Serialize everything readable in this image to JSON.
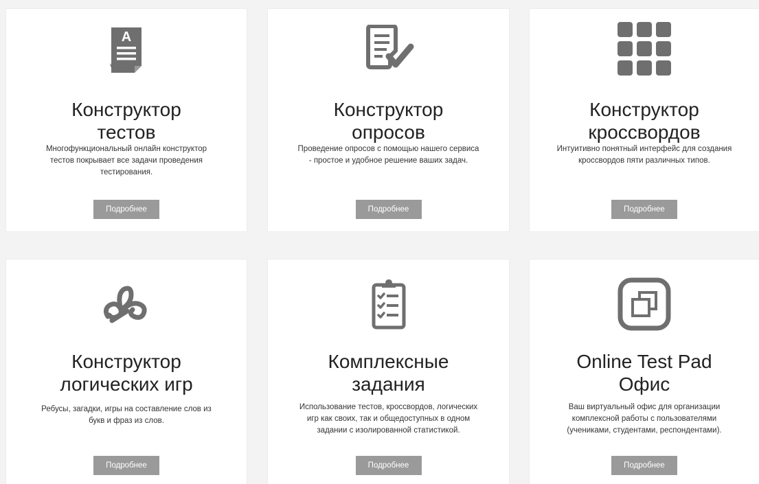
{
  "colors": {
    "background": "#f3f3f3",
    "card": "#ffffff",
    "icon": "#6f6f6f",
    "button": "#9a9a9a",
    "title": "#222222"
  },
  "cards": [
    {
      "icon": "document-a-icon",
      "title_lines": [
        "Конструктор",
        "тестов"
      ],
      "desc_lines": [
        "Многофункциональный онлайн конструктор",
        "тестов покрывает все задачи проведения",
        "тестирования."
      ],
      "button_label": "Подробнее"
    },
    {
      "icon": "survey-check-icon",
      "title_lines": [
        "Конструктор",
        "опросов"
      ],
      "desc_lines": [
        "Проведение опросов с помощью нашего сервиса",
        "- простое и удобное решение ваших задач."
      ],
      "button_label": "Подробнее"
    },
    {
      "icon": "crossword-grid-icon",
      "title_lines": [
        "Конструктор",
        "кроссвордов"
      ],
      "desc_lines": [
        "Интуитивно понятный интерфейс для создания",
        "кроссвордов пяти различных типов."
      ],
      "button_label": "Подробнее"
    },
    {
      "icon": "logic-games-icon",
      "title_lines": [
        "Конструктор",
        "логических игр"
      ],
      "desc_lines": [
        "Ребусы, загадки, игры на составление слов из",
        "букв и фраз из слов."
      ],
      "button_label": "Подробнее"
    },
    {
      "icon": "clipboard-checklist-icon",
      "title_lines": [
        "Комплексные",
        "задания"
      ],
      "desc_lines": [
        "Использование тестов, кроссвордов, логических",
        "игр как своих, так и общедоступных в одном",
        "задании с изолированной статистикой."
      ],
      "button_label": "Подробнее"
    },
    {
      "icon": "office-windows-icon",
      "title_lines": [
        "Online Test Pad",
        "Офис"
      ],
      "desc_lines": [
        "Ваш виртуальный офис для организации",
        "комплексной работы с пользователями",
        "(учениками, студентами, респондентами)."
      ],
      "button_label": "Подробнее"
    }
  ]
}
